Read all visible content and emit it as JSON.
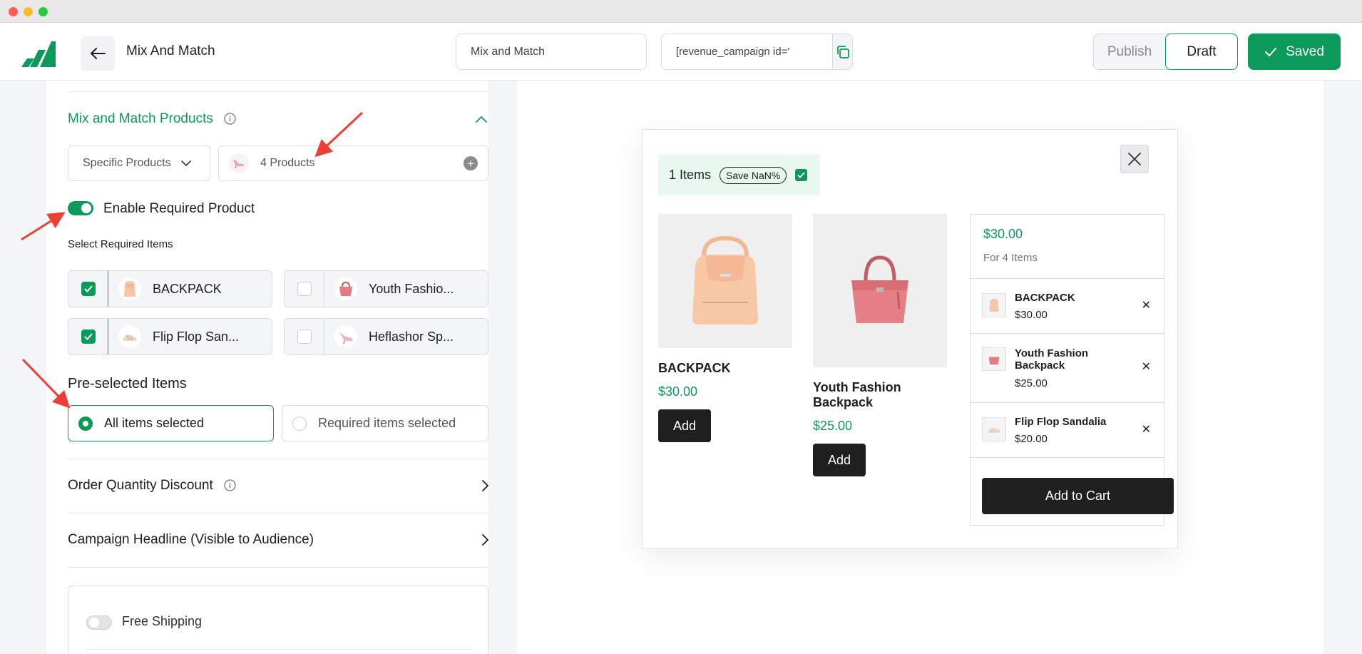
{
  "header": {
    "title": "Mix And Match",
    "campaign_name_value": "Mix and Match",
    "shortcode_value": "[revenue_campaign id='",
    "publish_label": "Publish",
    "draft_label": "Draft",
    "saved_label": "Saved"
  },
  "panel": {
    "section_title": "Mix and Match Products",
    "product_type": "Specific Products",
    "products_count": "4 Products",
    "enable_required_label": "Enable Required Product",
    "select_required_label": "Select Required Items",
    "required_items": [
      {
        "name": "BACKPACK",
        "checked": true
      },
      {
        "name": "Youth Fashio...",
        "checked": false
      },
      {
        "name": "Flip Flop San...",
        "checked": true
      },
      {
        "name": "Heflashor Sp...",
        "checked": false
      }
    ],
    "preselected_title": "Pre-selected Items",
    "preselected_options": [
      "All items selected",
      "Required items selected"
    ],
    "order_quantity_discount": "Order Quantity Discount",
    "campaign_headline": "Campaign Headline (Visible to Audience)",
    "free_shipping": "Free Shipping"
  },
  "preview": {
    "items_label": "1 Items",
    "save_label": "Save NaN%",
    "products": [
      {
        "name": "BACKPACK",
        "price": "$30.00",
        "add": "Add"
      },
      {
        "name": "Youth Fashion Backpack",
        "price": "$25.00",
        "add": "Add"
      }
    ],
    "summary": {
      "total": "$30.00",
      "for_items": "For 4 Items",
      "rows": [
        {
          "name": "BACKPACK",
          "price": "$30.00"
        },
        {
          "name": "Youth Fashion Backpack",
          "price": "$25.00"
        },
        {
          "name": "Flip Flop Sandalia",
          "price": "$20.00"
        }
      ],
      "cart_label": "Add to Cart"
    }
  },
  "colors": {
    "brand_green": "#0b9a5a",
    "dark": "#1f1f1f"
  }
}
